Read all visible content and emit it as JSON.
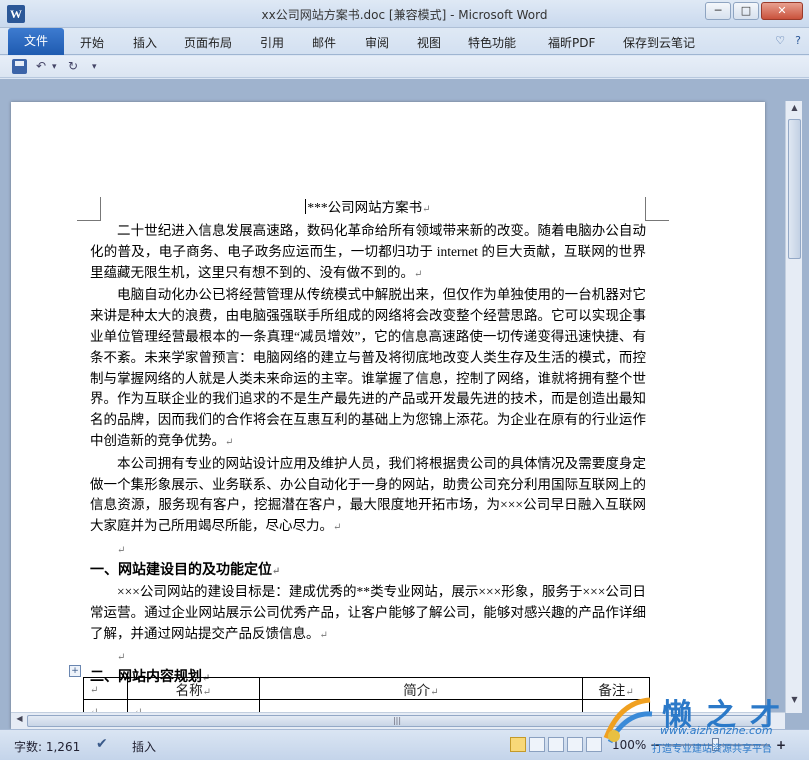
{
  "window": {
    "title": "xx公司网站方案书.doc [兼容模式]  -  Microsoft Word",
    "app_icon": "W",
    "buttons": {
      "minimize": "─",
      "maximize": "□",
      "close": "✕"
    }
  },
  "ribbon": {
    "file_tab": "文件",
    "tabs": [
      "开始",
      "插入",
      "页面布局",
      "引用",
      "邮件",
      "审阅",
      "视图",
      "特色功能",
      "福昕PDF",
      "保存到云笔记"
    ],
    "help": [
      "♡",
      "?"
    ]
  },
  "quick_access": {
    "undo": "↶",
    "undo_more": "▾",
    "redo": "↻",
    "customize": "▾"
  },
  "document": {
    "title": "***公司网站方案书",
    "paragraphs": [
      "二十世纪进入信息发展高速路，数码化革命给所有领域带来新的改变。随着电脑办公自动化的普及，电子商务、电子政务应运而生，一切都归功于 internet 的巨大贡献，互联网的世界里蕴藏无限生机，这里只有想不到的、没有做不到的。",
      "电脑自动化办公已将经营管理从传统模式中解脱出来，但仅作为单独使用的一台机器对它来讲是种太大的浪费，由电脑强强联手所组成的网络将会改变整个经营思路。它可以实现企事业单位管理经营最根本的一条真理“减员增效”，它的信息高速路使一切传递变得迅速快捷、有条不紊。未来学家曾预言：电脑网络的建立与普及将彻底地改变人类生存及生活的模式，而控制与掌握网络的人就是人类未来命运的主宰。谁掌握了信息，控制了网络，谁就将拥有整个世界。作为互联企业的我们追求的不是生产最先进的产品或开发最先进的技术，而是创造出最知名的品牌，因而我们的合作将会在互惠互利的基础上为您锦上添花。为企业在原有的行业运作中创造新的竞争优势。",
      "本公司拥有专业的网站设计应用及维护人员，我们将根据贵公司的具体情况及需要度身定做一个集形象展示、业务联系、办公自动化于一身的网站，助贵公司充分利用国际互联网上的信息资源，服务现有客户，挖掘潜在客户，最大限度地开拓市场，为×××公司早日融入互联网大家庭并为己所用竭尽所能，尽心尽力。"
    ],
    "heading1": "一、网站建设目的及功能定位",
    "paragraph4": "×××公司网站的建设目标是：建成优秀的**类专业网站，展示×××形象，服务于×××公司日常运营。通过企业网站展示公司优秀产品，让客户能够了解公司，能够对感兴趣的产品作详细了解，并通过网站提交产品反馈信息。",
    "heading2": "二、网站内容规划",
    "mark": "↵",
    "table": {
      "headers": [
        "",
        "名称",
        "简介",
        "备注"
      ],
      "row1": [
        "",
        "",
        "",
        ""
      ]
    }
  },
  "status": {
    "word_count": "字数: 1,261",
    "mode": "插入",
    "zoom": "100%",
    "zoom_minus": "−",
    "zoom_plus": "+"
  },
  "watermark": {
    "brand": "懒之才",
    "url": "www.aizhanzhe.com",
    "slogan": "打造专业建站资源共享平台"
  }
}
